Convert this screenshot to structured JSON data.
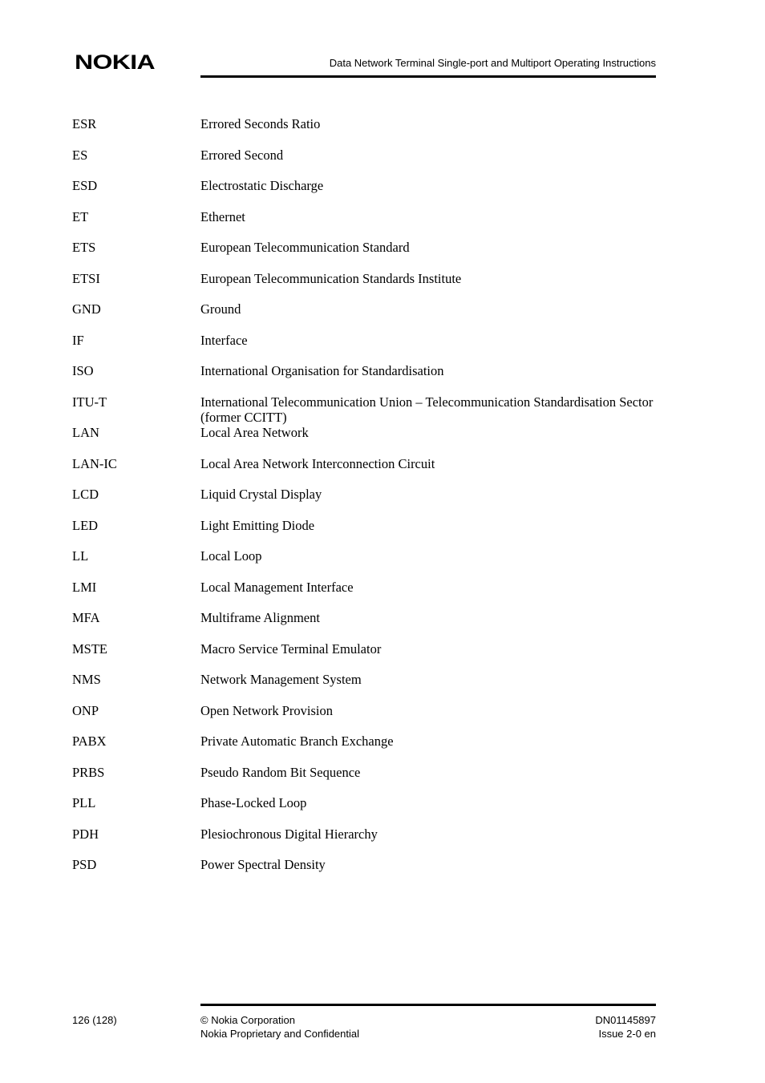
{
  "header": {
    "logo": "NOKIA",
    "title": "Data Network Terminal Single-port and Multiport Operating Instructions"
  },
  "glossary": [
    {
      "abbr": "ESR",
      "definition": "Errored Seconds Ratio"
    },
    {
      "abbr": "ES",
      "definition": "Errored Second"
    },
    {
      "abbr": "ESD",
      "definition": "Electrostatic Discharge"
    },
    {
      "abbr": "ET",
      "definition": "Ethernet"
    },
    {
      "abbr": "ETS",
      "definition": "European Telecommunication Standard"
    },
    {
      "abbr": "ETSI",
      "definition": "European Telecommunication Standards Institute"
    },
    {
      "abbr": "GND",
      "definition": "Ground"
    },
    {
      "abbr": "IF",
      "definition": "Interface"
    },
    {
      "abbr": "ISO",
      "definition": "International Organisation for Standardisation"
    },
    {
      "abbr": "ITU-T",
      "definition": "International Telecommunication Union – Telecommunication Standardisation Sector (former CCITT)"
    },
    {
      "abbr": "LAN",
      "definition": "Local Area Network"
    },
    {
      "abbr": "LAN-IC",
      "definition": "Local Area Network Interconnection Circuit"
    },
    {
      "abbr": "LCD",
      "definition": "Liquid Crystal Display"
    },
    {
      "abbr": "LED",
      "definition": "Light Emitting Diode"
    },
    {
      "abbr": "LL",
      "definition": "Local Loop"
    },
    {
      "abbr": "LMI",
      "definition": "Local Management Interface"
    },
    {
      "abbr": "MFA",
      "definition": "Multiframe Alignment"
    },
    {
      "abbr": "MSTE",
      "definition": "Macro Service Terminal Emulator"
    },
    {
      "abbr": "NMS",
      "definition": "Network Management System"
    },
    {
      "abbr": "ONP",
      "definition": "Open Network Provision"
    },
    {
      "abbr": "PABX",
      "definition": "Private Automatic Branch Exchange"
    },
    {
      "abbr": "PRBS",
      "definition": "Pseudo Random Bit Sequence"
    },
    {
      "abbr": "PLL",
      "definition": "Phase-Locked Loop"
    },
    {
      "abbr": "PDH",
      "definition": "Plesiochronous Digital Hierarchy"
    },
    {
      "abbr": "PSD",
      "definition": "Power Spectral Density"
    }
  ],
  "footer": {
    "page": "126 (128)",
    "copyright": "© Nokia Corporation",
    "confidential": "Nokia Proprietary and Confidential",
    "doc_id": "DN01145897",
    "issue": "Issue 2-0 en"
  }
}
